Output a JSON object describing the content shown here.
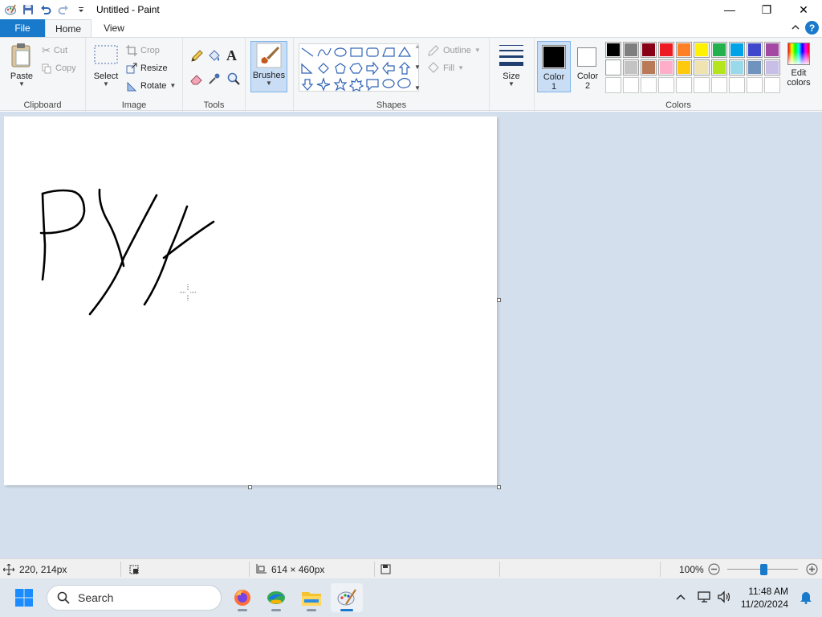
{
  "window": {
    "title": "Untitled - Paint",
    "minimize_symbol": "—",
    "maximize_symbol": "❐",
    "close_symbol": "✕"
  },
  "tabs": {
    "file": "File",
    "home": "Home",
    "view": "View",
    "help_symbol": "?"
  },
  "ribbon": {
    "clipboard": {
      "label": "Clipboard",
      "paste": "Paste",
      "cut": "Cut",
      "copy": "Copy"
    },
    "image": {
      "label": "Image",
      "select": "Select",
      "crop": "Crop",
      "resize": "Resize",
      "rotate": "Rotate"
    },
    "tools": {
      "label": "Tools",
      "text_tool": "A"
    },
    "brushes": {
      "label": "Brushes"
    },
    "shapes": {
      "label": "Shapes",
      "outline": "Outline",
      "fill": "Fill"
    },
    "size": {
      "label": "Size"
    },
    "colors": {
      "label": "Colors",
      "color1_label": "Color",
      "color1_num": "1",
      "color2_label": "Color",
      "color2_num": "2",
      "edit_label": "Edit",
      "edit_label2": "colors",
      "color1_value": "#000000",
      "color2_value": "#ffffff",
      "palette_row1": [
        "#000000",
        "#7f7f7f",
        "#880015",
        "#ed1c24",
        "#ff7f27",
        "#fff200",
        "#22b14c",
        "#00a2e8",
        "#3f48cc",
        "#a349a4"
      ],
      "palette_row2": [
        "#ffffff",
        "#c3c3c3",
        "#b97a57",
        "#ffaec9",
        "#ffc90e",
        "#efe4b0",
        "#b5e61d",
        "#99d9ea",
        "#7092be",
        "#c8bfe7"
      ]
    }
  },
  "canvas": {
    "background": "#ffffff"
  },
  "status": {
    "cursor_pos": "220, 214px",
    "canvas_size": "614 × 460px",
    "zoom": "100%",
    "zoom_level": 0.5
  },
  "taskbar": {
    "search_label": "Search",
    "time": "11:48 AM",
    "date": "11/20/2024"
  }
}
